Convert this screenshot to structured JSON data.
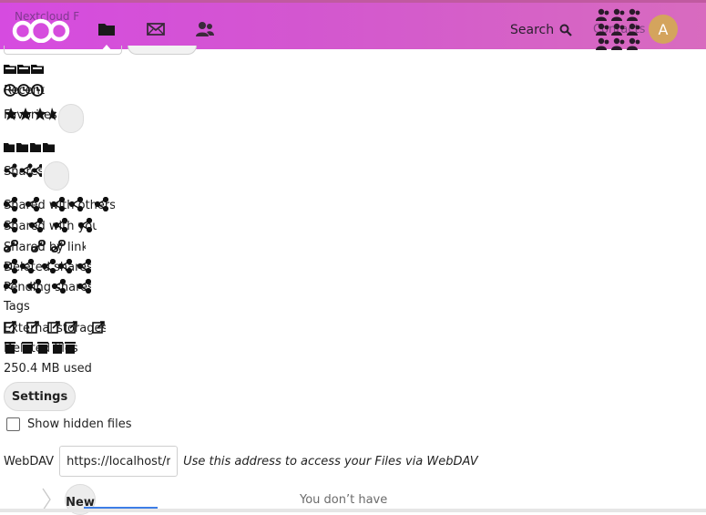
{
  "header": {
    "app_name": "Nextcloud F",
    "search_label": "Search",
    "contacts_label": "Contacts",
    "avatar_letter": "A",
    "colors": {
      "gradient_start": "#d64be0",
      "gradient_end": "#d86bbf",
      "avatar": "#d4a45d"
    },
    "apps": [
      {
        "name": "files",
        "icon": "folder-icon",
        "active": true
      },
      {
        "name": "mail",
        "icon": "mail-icon",
        "active": false
      },
      {
        "name": "contacts",
        "icon": "contacts-icon",
        "active": false
      }
    ]
  },
  "nav": {
    "recent": "Recent",
    "favorites": "Favorites",
    "shares": "Shares",
    "shared_with_others": "Shared with others",
    "shared_with_you": "Shared with you",
    "shared_by_link": "Shared by link",
    "deleted_shares": "Deleted shares",
    "pending_shares": "Pending shares",
    "tags": "Tags",
    "external_storages": "External storages",
    "deleted_files": "Deleted files"
  },
  "settings": {
    "quota": "250.4 MB used",
    "settings_label": "Settings",
    "show_hidden": "Show hidden files",
    "webdav_label": "WebDAV",
    "webdav_url": "https://localhost/remote.php/dav/files/admin/",
    "webdav_hint": "Use this address to access your Files via WebDAV"
  },
  "controls": {
    "new_label": "New",
    "no_permission": "You don’t have"
  }
}
